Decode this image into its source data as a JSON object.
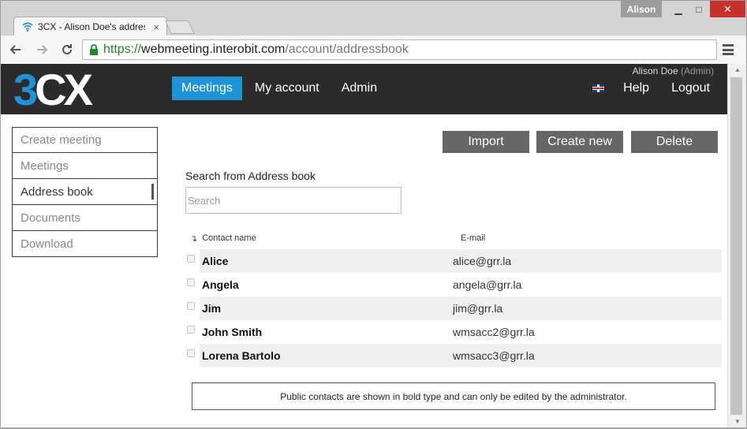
{
  "browser": {
    "tab_title": "3CX - Alison Doe's addres",
    "tab_close": "×",
    "profile_name": "Alison",
    "window_min": "▁",
    "window_max": "□",
    "window_close": "✕",
    "url_scheme": "https://",
    "url_host": "webmeeting.interobit.com",
    "url_path": "/account/addressbook"
  },
  "header": {
    "logo_three": "3",
    "logo_cx": "CX",
    "user_name": "Alison Doe",
    "user_role": "(Admin)",
    "nav": [
      {
        "label": "Meetings",
        "active": true
      },
      {
        "label": "My account",
        "active": false
      },
      {
        "label": "Admin",
        "active": false
      }
    ],
    "help_label": "Help",
    "logout_label": "Logout"
  },
  "sidebar": {
    "items": [
      {
        "label": "Create meeting",
        "active": false
      },
      {
        "label": "Meetings",
        "active": false
      },
      {
        "label": "Address book",
        "active": true
      },
      {
        "label": "Documents",
        "active": false
      },
      {
        "label": "Download",
        "active": false
      }
    ]
  },
  "actions": {
    "import_label": "Import",
    "create_label": "Create new",
    "delete_label": "Delete"
  },
  "search": {
    "label": "Search from Address book",
    "placeholder": "Search",
    "value": ""
  },
  "table": {
    "sort_icon": "↴",
    "col_name": "Contact name",
    "col_email": "E-mail",
    "rows": [
      {
        "name": "Alice",
        "email": "alice@grr.la",
        "banded": true
      },
      {
        "name": "Angela",
        "email": "angela@grr.la",
        "banded": false
      },
      {
        "name": "Jim",
        "email": "jim@grr.la",
        "banded": true
      },
      {
        "name": "John Smith",
        "email": "wmsacc2@grr.la",
        "banded": false
      },
      {
        "name": "Lorena Bartolo",
        "email": "wmsacc3@grr.la",
        "banded": true
      }
    ]
  },
  "notice": "Public contacts are shown in bold type and can only be edited by the administrator.",
  "colors": {
    "accent": "#1e94d6",
    "header_bg": "#2b2b2b",
    "button_bg": "#666666",
    "row_band": "#efefef"
  }
}
